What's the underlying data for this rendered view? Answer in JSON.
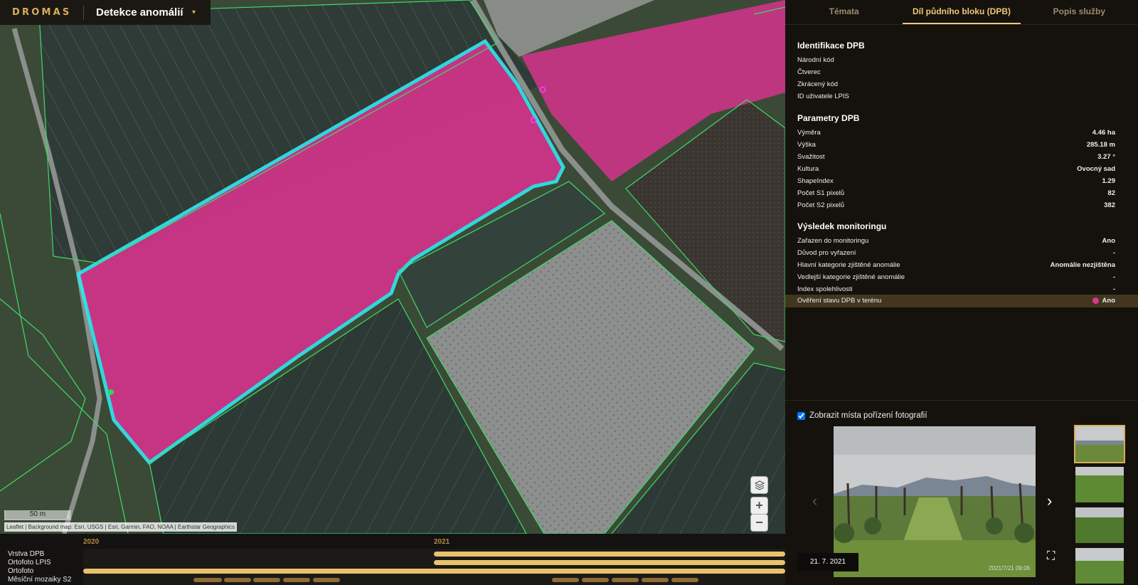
{
  "app": {
    "logo": "DROMAS",
    "title": "Detekce anomálií",
    "caret": "▾"
  },
  "map": {
    "scale_label": "50 m",
    "attribution": "Leaflet | Background map: Esri, USGS | Esri, Garmin, FAO, NOAA | Earthstar Geographics",
    "controls": {
      "layers_icon": "layers-icon",
      "zoom_in": "+",
      "zoom_out": "−"
    },
    "colors": {
      "anomaly_fill": "#d6338c",
      "selected_outline": "#2fe8f0",
      "lpis_lines": "#3ddc6a"
    }
  },
  "timeline": {
    "years": [
      "2020",
      "2021"
    ],
    "rows": [
      "Vrstva DPB",
      "Ortofoto LPIS",
      "Ortofoto",
      "Měsíční mozaiky S2"
    ]
  },
  "tabs": [
    {
      "label": "Témata"
    },
    {
      "label": "Díl půdního bloku (DPB)"
    },
    {
      "label": "Popis služby"
    }
  ],
  "identification": {
    "heading": "Identifikace DPB",
    "rows": [
      {
        "k": "Národní kód",
        "v": ""
      },
      {
        "k": "Čtverec",
        "v": ""
      },
      {
        "k": "Zkrácený kód",
        "v": ""
      },
      {
        "k": "ID uživatele LPIS",
        "v": ""
      }
    ]
  },
  "parameters": {
    "heading": "Parametry DPB",
    "rows": [
      {
        "k": "Výměra",
        "v": "4.46 ha"
      },
      {
        "k": "Výška",
        "v": "285.18 m"
      },
      {
        "k": "Svažitost",
        "v": "3.27 °"
      },
      {
        "k": "Kultura",
        "v": "Ovocný sad"
      },
      {
        "k": "ShapeIndex",
        "v": "1.29"
      },
      {
        "k": "Počet S1 pixelů",
        "v": "82"
      },
      {
        "k": "Počet S2 pixelů",
        "v": "382"
      }
    ]
  },
  "monitoring": {
    "heading": "Výsledek monitoringu",
    "rows": [
      {
        "k": "Zařazen do monitoringu",
        "v": "Ano"
      },
      {
        "k": "Důvod pro vyřazení",
        "v": "-"
      },
      {
        "k": "Hlavní kategorie zjištěné anomálie",
        "v": "Anomálie nezjištěna"
      },
      {
        "k": "Vedlejší kategorie zjištěné anomálie",
        "v": "-"
      },
      {
        "k": "Index spolehlivosti",
        "v": "-"
      }
    ],
    "field_check": {
      "k": "Ověření stavu DPB v terénu",
      "v": "Ano",
      "dot_color": "#e0358f"
    }
  },
  "photos": {
    "show_label": "Zobrazit místa pořízení fotografií",
    "checked": true,
    "date": "21. 7. 2021",
    "stamp": "2021/7/21 09:06",
    "prev": "‹",
    "next": "›",
    "fullscreen": "⛶"
  }
}
